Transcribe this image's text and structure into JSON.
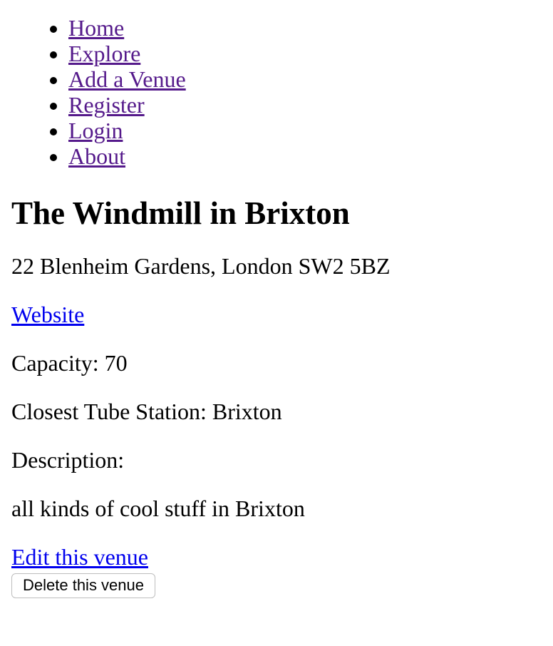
{
  "nav": {
    "items": [
      {
        "label": "Home"
      },
      {
        "label": "Explore"
      },
      {
        "label": "Add a Venue"
      },
      {
        "label": "Register"
      },
      {
        "label": "Login"
      },
      {
        "label": "About"
      }
    ]
  },
  "venue": {
    "title": "The Windmill in Brixton",
    "address": "22 Blenheim Gardens, London SW2 5BZ",
    "website_label": "Website",
    "capacity": "Capacity: 70",
    "tube": "Closest Tube Station: Brixton",
    "description_label": "Description:",
    "description": "all kinds of cool stuff in Brixton"
  },
  "actions": {
    "edit_label": "Edit this venue",
    "delete_label": "Delete this venue"
  },
  "colors": {
    "visited_link": "#551a8b",
    "link": "#0000ee",
    "text": "#000000",
    "background": "#ffffff"
  }
}
